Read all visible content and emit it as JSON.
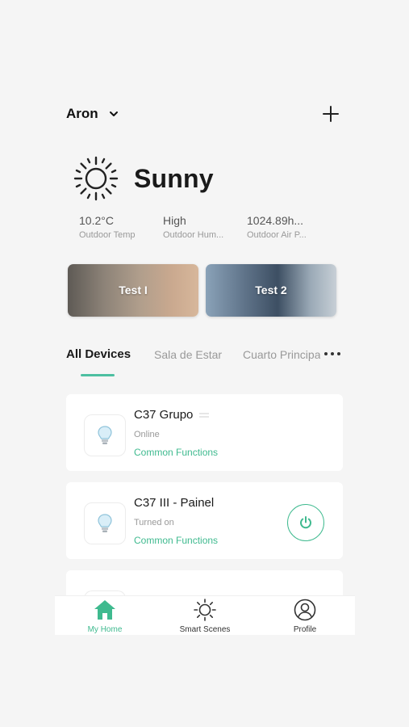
{
  "header": {
    "home_name": "Aron"
  },
  "weather": {
    "condition": "Sunny",
    "stats": [
      {
        "value": "10.2°C",
        "label": "Outdoor Temp"
      },
      {
        "value": "High",
        "label": "Outdoor Hum..."
      },
      {
        "value": "1024.89h...",
        "label": "Outdoor Air P..."
      }
    ]
  },
  "scenes": [
    {
      "label": "Test I"
    },
    {
      "label": "Test 2"
    }
  ],
  "tabs": [
    "All Devices",
    "Sala de Estar",
    "Cuarto Principal"
  ],
  "devices": [
    {
      "name": "C37 Grupo",
      "status": "Online",
      "functions": "Common Functions"
    },
    {
      "name": "C37 III - Painel",
      "status": "Turned on",
      "functions": "Common Functions"
    }
  ],
  "nav": [
    {
      "label": "My Home",
      "icon": "home-icon"
    },
    {
      "label": "Smart Scenes",
      "icon": "sun-icon"
    },
    {
      "label": "Profile",
      "icon": "profile-icon"
    }
  ],
  "colors": {
    "accent": "#3fba8f",
    "tab_underline": "#4dbfa1"
  }
}
